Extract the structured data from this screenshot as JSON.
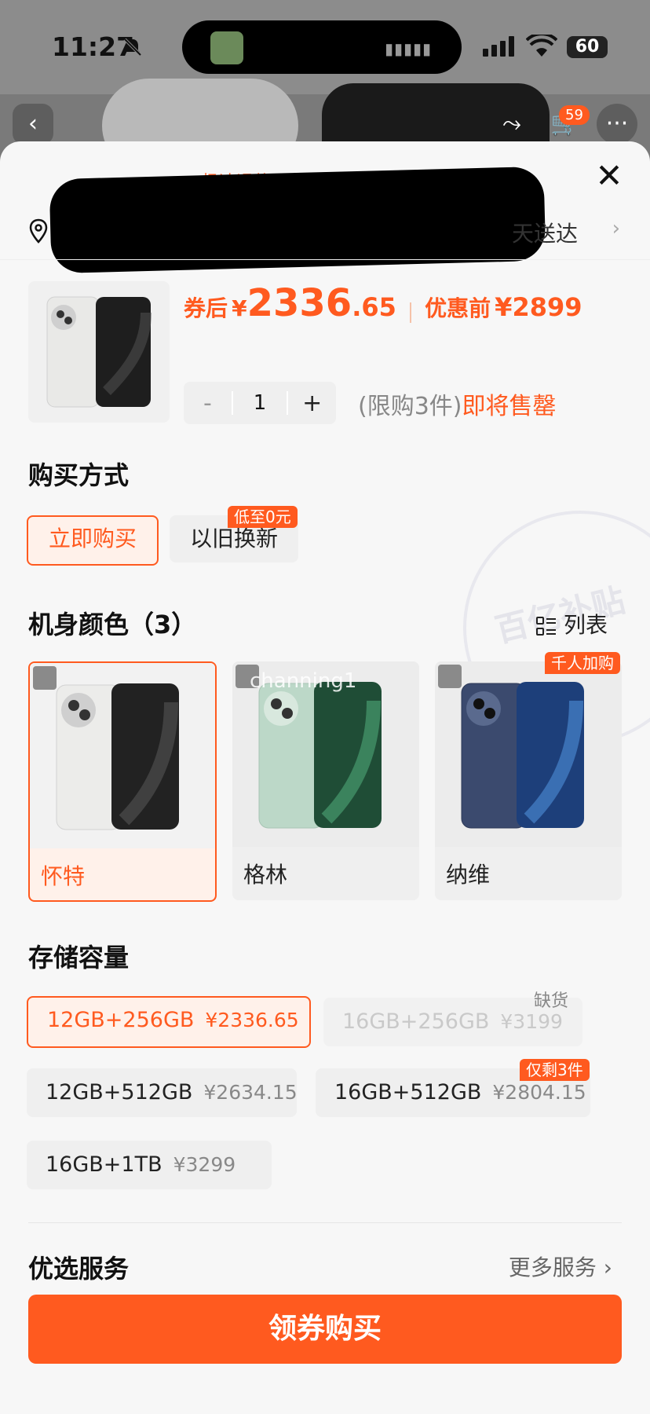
{
  "status_bar": {
    "time": "11:27",
    "battery": "60"
  },
  "top_nav": {
    "cart_count": "59"
  },
  "sheet": {
    "promo": "极速退款·退货宝·7天无理由退换",
    "delivery": "天送达",
    "price": {
      "after_label": "券后",
      "after_yen": "¥",
      "after_integer": "2336",
      "after_decimal": ".65",
      "before_label": "优惠前",
      "before_value": "¥2899"
    },
    "quantity": {
      "minus": "-",
      "value": "1",
      "plus": "+"
    },
    "limit": {
      "text": "(限购3件)",
      "hot": "即将售罄"
    }
  },
  "purchase": {
    "title": "购买方式",
    "options": [
      {
        "label": "立即购买",
        "selected": true
      },
      {
        "label": "以旧换新",
        "tag": "低至0元"
      }
    ]
  },
  "stamp_text": "百亿补贴",
  "colors": {
    "title": "机身颜色（3）",
    "list_toggle": "列表",
    "items": [
      {
        "name": "怀特",
        "selected": true,
        "phone_colors": [
          "#e8e8e6",
          "#2a2a2a"
        ]
      },
      {
        "name": "格林",
        "phone_colors": [
          "#bcd8c8",
          "#2f6a4a"
        ]
      },
      {
        "name": "纳维",
        "tag": "千人加购",
        "phone_colors": [
          "#3b4a6e",
          "#2a5ea8"
        ]
      }
    ],
    "watermark": "channing1"
  },
  "storage": {
    "title": "存储容量",
    "options": [
      {
        "spec": "12GB+256GB",
        "price": "¥2336.65",
        "selected": true
      },
      {
        "spec": "16GB+256GB",
        "price": "¥3199",
        "disabled": true,
        "tag": "缺货"
      },
      {
        "spec": "12GB+512GB",
        "price": "¥2634.15"
      },
      {
        "spec": "16GB+512GB",
        "price": "¥2804.15",
        "tag": "仅剩3件"
      },
      {
        "spec": "16GB+1TB",
        "price": "¥3299"
      }
    ]
  },
  "services": {
    "title": "优选服务",
    "more": "更多服务 ›"
  },
  "cta": {
    "label": "领券购买"
  },
  "theme": {
    "accent": "#ff5a1f",
    "accent_light": "#fff1ea"
  }
}
